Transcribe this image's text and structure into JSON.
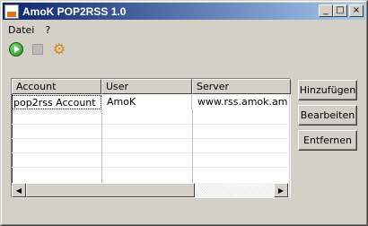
{
  "window": {
    "title": "AmoK POP2RSS 1.0"
  },
  "titlebar_buttons": {
    "minimize": "_",
    "maximize": "□",
    "close": "×"
  },
  "menu": {
    "items": [
      {
        "label": "Datei"
      },
      {
        "label": "?"
      }
    ]
  },
  "toolbar": {
    "icons": [
      "start-icon",
      "stop-icon",
      "settings-gears-icon"
    ]
  },
  "table": {
    "columns": [
      "Account",
      "User",
      "Server"
    ],
    "rows": [
      {
        "account": "pop2rss Account",
        "user": "AmoK",
        "server": "www.rss.amok.am"
      }
    ]
  },
  "buttons": {
    "add": "Hinzufügen",
    "edit": "Bearbeiten",
    "remove": "Entfernen"
  },
  "colors": {
    "titlebar_start": "#0a246a",
    "titlebar_end": "#a6caf0",
    "face": "#d4d0c8"
  }
}
